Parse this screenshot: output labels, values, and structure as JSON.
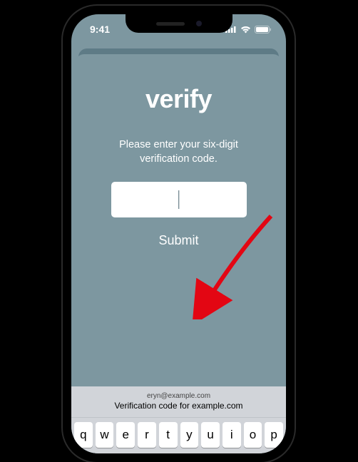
{
  "status": {
    "time": "9:41"
  },
  "verify": {
    "title": "verify",
    "instruction_l1": "Please enter your six-digit",
    "instruction_l2": "verification code.",
    "submit_label": "Submit"
  },
  "keyboard": {
    "suggestion_email": "eryn@example.com",
    "suggestion_text": "Verification code for example.com",
    "row1": [
      "q",
      "w",
      "e",
      "r",
      "t",
      "y",
      "u",
      "i",
      "o",
      "p"
    ]
  }
}
